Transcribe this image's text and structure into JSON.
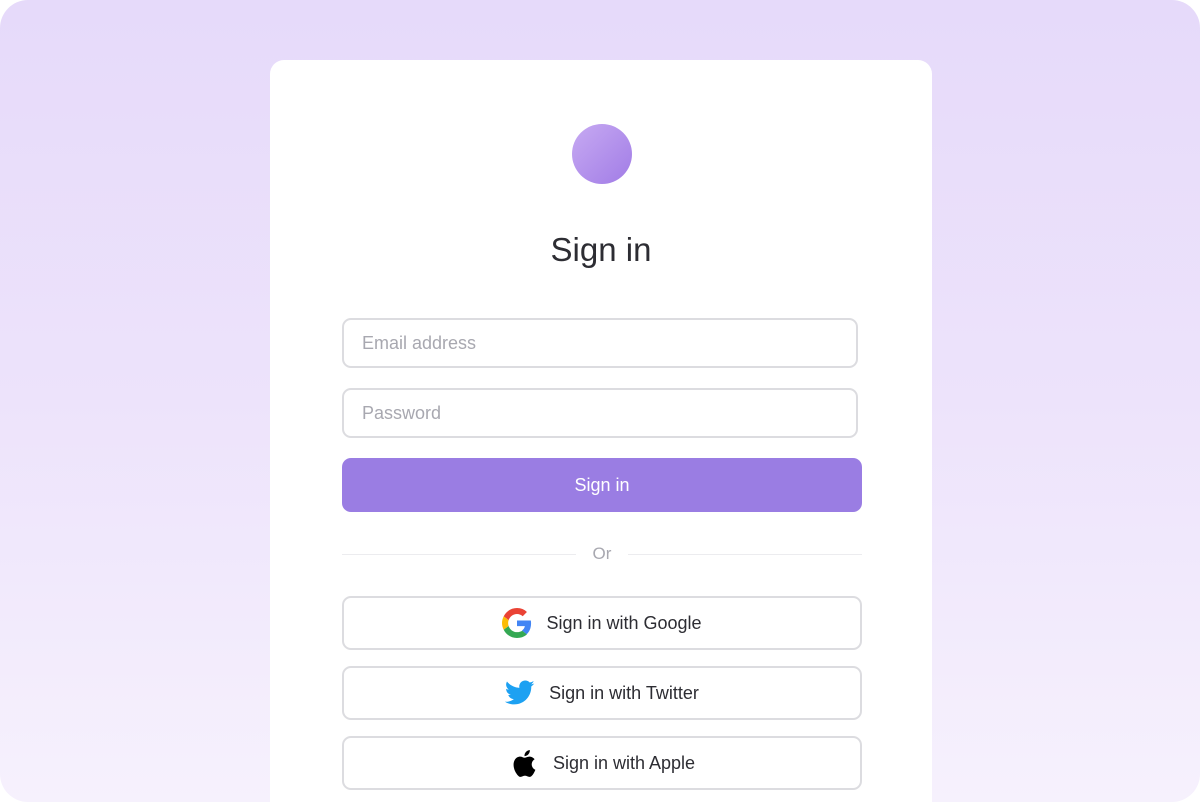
{
  "brand": {
    "logo_gradient_start": "#c7aaf2",
    "logo_gradient_end": "#a17ce6",
    "accent": "#9a7de3"
  },
  "login": {
    "title": "Sign in",
    "email_placeholder": "Email address",
    "password_placeholder": "Password",
    "submit_label": "Sign in",
    "divider_text": "Or"
  },
  "social": {
    "google": {
      "label": "Sign in with Google",
      "icon": "google-icon"
    },
    "twitter": {
      "label": "Sign in with Twitter",
      "icon": "twitter-icon"
    },
    "apple": {
      "label": "Sign in with Apple",
      "icon": "apple-icon"
    }
  }
}
